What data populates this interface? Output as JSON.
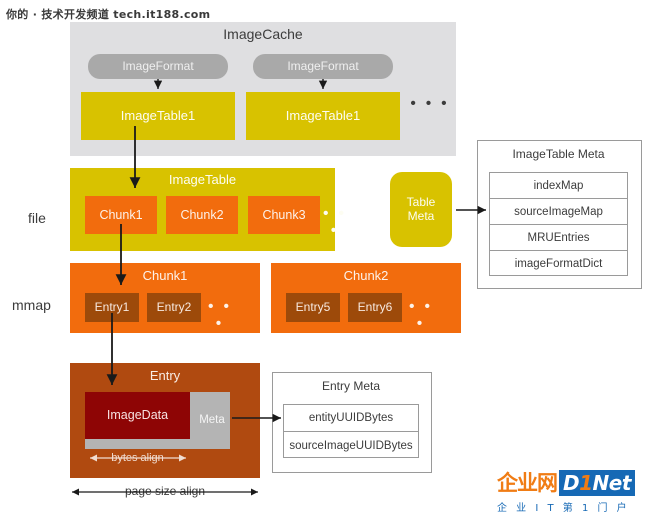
{
  "watermark": "你的 · 技术开发频道  tech.it188.com",
  "layers": {
    "file_label": "file",
    "mmap_label": "mmap"
  },
  "image_cache": {
    "title": "ImageCache",
    "columns": [
      {
        "format_label": "ImageFormat",
        "table_label": "ImageTable1"
      },
      {
        "format_label": "ImageFormat",
        "table_label": "ImageTable1"
      }
    ],
    "ellipsis": "• • •"
  },
  "image_table": {
    "title": "ImageTable",
    "chunks": [
      "Chunk1",
      "Chunk2",
      "Chunk3"
    ],
    "ellipsis": "• • •"
  },
  "table_meta": {
    "line1": "Table",
    "line2": "Meta"
  },
  "image_table_meta": {
    "title": "ImageTable Meta",
    "rows": [
      "indexMap",
      "sourceImageMap",
      "MRUEntries",
      "imageFormatDict"
    ]
  },
  "mmap_chunks": [
    {
      "title": "Chunk1",
      "entries": [
        "Entry1",
        "Entry2"
      ],
      "ellipsis": "• • •"
    },
    {
      "title": "Chunk2",
      "entries": [
        "Entry5",
        "Entry6"
      ],
      "ellipsis": "• • •"
    }
  ],
  "entry": {
    "title": "Entry",
    "image_data_label": "ImageData",
    "meta_label": "Meta",
    "bytes_align_label": "bytes align",
    "page_size_align_label": "page size align"
  },
  "entry_meta": {
    "title": "Entry Meta",
    "rows": [
      "entityUUIDBytes",
      "sourceImageUUIDBytes"
    ]
  },
  "logo": {
    "cn": "企业网",
    "brand_d": "D",
    "brand_one": "1",
    "brand_net": "Net",
    "subtitle": "企 业 I T 第 1 门 户"
  },
  "colors": {
    "gray_panel": "#dfdfe1",
    "pill_gray": "#a9a9a9",
    "yellow": "#d8c200",
    "orange": "#f26c0d",
    "dark_orange": "#9d4a0a",
    "brown": "#b04a10",
    "dark_red": "#8e0505",
    "meta_gray": "#b4b4b4",
    "text_dark": "#3c3c3c",
    "logo_orange": "#f07c14",
    "logo_blue": "#1669b5"
  }
}
